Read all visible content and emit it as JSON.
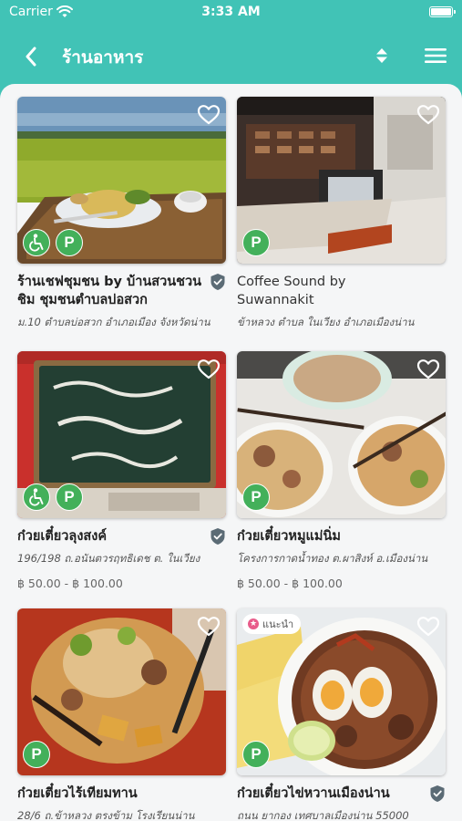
{
  "status": {
    "carrier": "Carrier",
    "time": "3:33 AM"
  },
  "nav": {
    "title": "ร้านอาหาร"
  },
  "colors": {
    "header": "#41c3b6",
    "badge": "#43b05a",
    "verified": "#5b6b75",
    "promo": "#e85b8a"
  },
  "cards": [
    {
      "name": "ร้านเชฟชุมชน by บ้านสวนชวน ชิม ชุมชนตำบลบ่อสวก",
      "address": "ม.10 ตำบลบ่อสวก อำเภอเมือง จังหวัดน่าน",
      "price": "",
      "verified": true,
      "promo": "",
      "badges": [
        "wheelchair-icon",
        "P"
      ]
    },
    {
      "name": "Coffee Sound by Suwannakit",
      "address": "ข้าหลวง ตำบล ในเวียง อำเภอเมืองน่าน",
      "price": "",
      "verified": false,
      "promo": "",
      "badges": [
        "P"
      ]
    },
    {
      "name": "ก๋วยเตี๋ยวลุงสงค์",
      "address": "196/198 ถ.อนันตวรฤทธิเดช ต. ในเวียง",
      "price": "฿ 50.00 - ฿ 100.00",
      "verified": true,
      "promo": "",
      "badges": [
        "wheelchair-icon",
        "P"
      ]
    },
    {
      "name": "ก๋วยเตี๋ยวหมูแม่นิ่ม",
      "address": "โครงการกาดน้ำทอง ต.ผาสิงห์ อ.เมืองน่าน",
      "price": "฿ 50.00 - ฿ 100.00",
      "verified": false,
      "promo": "",
      "badges": [
        "P"
      ]
    },
    {
      "name": "ก๋วยเตี๋ยวไร้เทียมทาน",
      "address": "28/6 ถ.ข้าหลวง ตรงข้าม โรงเรียนน่าน",
      "price": "",
      "verified": false,
      "promo": "",
      "badges": [
        "P"
      ]
    },
    {
      "name": "ก๋วยเตี๋ยวไข่หวานเมืองน่าน",
      "address": "ถนน ยากอง เทศบาลเมืองน่าน 55000",
      "price": "",
      "verified": true,
      "promo": "แนะนำ",
      "badges": [
        "P"
      ]
    }
  ]
}
